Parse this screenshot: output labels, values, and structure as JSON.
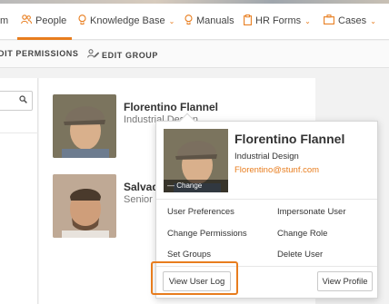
{
  "nav": {
    "partial_first": "m",
    "items": [
      {
        "label": "People",
        "icon": "people-icon"
      },
      {
        "label": "Knowledge Base",
        "icon": "lightbulb-icon"
      },
      {
        "label": "Manuals",
        "icon": "bulb-icon"
      },
      {
        "label": "HR Forms",
        "icon": "clipboard-icon"
      },
      {
        "label": "Cases",
        "icon": "briefcase-icon"
      }
    ]
  },
  "subbar": {
    "permissions": "DIT PERMISSIONS",
    "edit_group": "EDIT GROUP"
  },
  "search": {
    "placeholder": ""
  },
  "people": [
    {
      "name": "Florentino Flannel",
      "dept": "Industrial Design"
    },
    {
      "name": "Salvad",
      "dept": "Senior"
    }
  ],
  "popover": {
    "name": "Florentino Flannel",
    "dept": "Industrial Design",
    "email": "Florentino@stunf.com",
    "change_label": "— Change",
    "actions_left": [
      "User Preferences",
      "Change Permissions",
      "Set Groups"
    ],
    "actions_right": [
      "Impersonate User",
      "Change Role",
      "Delete User"
    ],
    "view_log": "View User Log",
    "view_profile": "View Profile"
  },
  "colors": {
    "accent": "#e87d1e"
  }
}
